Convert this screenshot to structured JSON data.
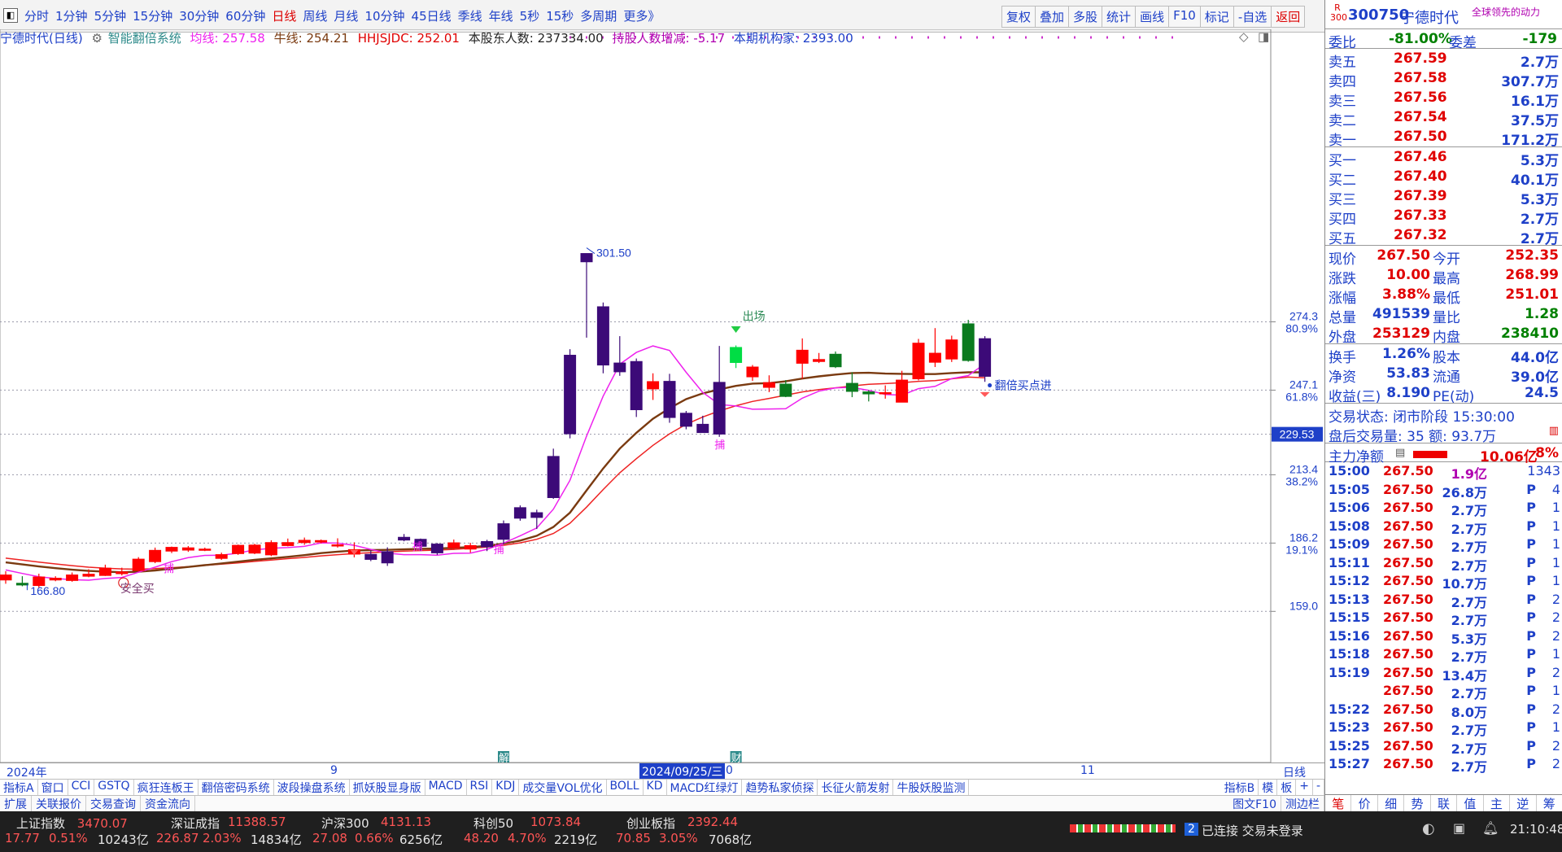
{
  "toolbar": {
    "periods": [
      "分时",
      "1分钟",
      "5分钟",
      "15分钟",
      "30分钟",
      "60分钟",
      "日线",
      "周线",
      "月线",
      "10分钟",
      "45日线",
      "季线",
      "年线",
      "5秒",
      "15秒",
      "多周期",
      "更多》"
    ],
    "active_period": "日线",
    "tools": [
      "复权",
      "叠加",
      "多股",
      "统计",
      "画线",
      "F10",
      "标记",
      "-自选",
      "返回"
    ]
  },
  "chart_info": {
    "stock": "宁德时代(日线)",
    "system": "智能翻倍系统",
    "junxian": "均线: 257.58",
    "niuxian": "牛线: 254.21",
    "hhjsjdc": "HHJSJDC: 252.01",
    "holders": "本股东人数: 237334.00",
    "holders_change": "持股人数增减: -5.17",
    "institutions": "本期机构家: 2393.00"
  },
  "chart_data": {
    "type": "candlestick",
    "yticks": [
      {
        "price": "274.3",
        "pct": "80.9%"
      },
      {
        "price": "247.1",
        "pct": "61.8%"
      },
      {
        "price": "229.53",
        "pct": ""
      },
      {
        "price": "213.4",
        "pct": "38.2%"
      },
      {
        "price": "186.2",
        "pct": "19.1%"
      },
      {
        "price": "159.0",
        "pct": ""
      }
    ],
    "ylim": [
      156,
      312
    ],
    "candles": [
      [
        1,
        173.5,
        171.5,
        175,
        170
      ],
      [
        0,
        169.5,
        170.2,
        173,
        169
      ],
      [
        1,
        169.3,
        172.7,
        174,
        168.5
      ],
      [
        1,
        171.5,
        172.2,
        173,
        171
      ],
      [
        1,
        171.3,
        173.5,
        174.5,
        170.8
      ],
      [
        1,
        173,
        173.8,
        175.8,
        172.6
      ],
      [
        1,
        173.3,
        176.2,
        177.6,
        173.1
      ],
      [
        1,
        174,
        174.7,
        176.4,
        173.3
      ],
      [
        1,
        175.3,
        179.8,
        180.6,
        175
      ],
      [
        1,
        178.8,
        183.3,
        184.4,
        178.2
      ],
      [
        1,
        183,
        184.5,
        184.8,
        182.2
      ],
      [
        1,
        183.4,
        184.3,
        185,
        182.7
      ],
      [
        1,
        183.4,
        183.8,
        184.4,
        183
      ],
      [
        1,
        180.1,
        181.6,
        182.4,
        179.5
      ],
      [
        1,
        182,
        185.3,
        185.6,
        181.5
      ],
      [
        1,
        182.2,
        185.4,
        185.9,
        181.8
      ],
      [
        1,
        181.5,
        186.4,
        187.3,
        181
      ],
      [
        1,
        186.4,
        185.2,
        188,
        184.9
      ],
      [
        1,
        186.4,
        187.3,
        188.4,
        185.5
      ],
      [
        1,
        187.2,
        186.6,
        187.6,
        186.1
      ],
      [
        1,
        185.5,
        185.4,
        188.1,
        184.4
      ],
      [
        1,
        183.6,
        181.8,
        186.5,
        180.5
      ],
      [
        0,
        181.7,
        179.7,
        183.2,
        179
      ],
      [
        0,
        182.8,
        178.3,
        184.5,
        177.1
      ],
      [
        0,
        188.5,
        187.4,
        189.8,
        186.9
      ],
      [
        0,
        184.9,
        187.7,
        188,
        183
      ],
      [
        0,
        185.8,
        182.3,
        186.2,
        181.5
      ],
      [
        1,
        184.3,
        186.3,
        187.6,
        183.6
      ],
      [
        1,
        183.8,
        185.2,
        186.3,
        182.4
      ],
      [
        0,
        186.8,
        184.7,
        187.5,
        183
      ],
      [
        0,
        187.7,
        193.9,
        195.2,
        185.8
      ],
      [
        0,
        200.3,
        196.1,
        201.2,
        195.1
      ],
      [
        0,
        198.3,
        196.4,
        199.5,
        191.8
      ],
      [
        0,
        204.3,
        220.7,
        223.8,
        203.8
      ],
      [
        0,
        229.7,
        261,
        263.4,
        227.9
      ],
      [
        0,
        301.5,
        298.2,
        301.5,
        268
      ],
      [
        0,
        257.1,
        280.3,
        282,
        253.8
      ],
      [
        0,
        257.9,
        254.4,
        268.6,
        252.8
      ],
      [
        0,
        258.5,
        239.3,
        259.7,
        236.4
      ],
      [
        1,
        247.6,
        250.5,
        253.8,
        243.2
      ],
      [
        0,
        250.6,
        236.2,
        253.6,
        234.1
      ],
      [
        0,
        232.7,
        237.9,
        238.8,
        231.5
      ],
      [
        0,
        233.5,
        230.2,
        236.9,
        230.1
      ],
      [
        0,
        229.6,
        250.2,
        264.7,
        228.5
      ],
      [
        2,
        264.1,
        258.1,
        264.9,
        255.9
      ],
      [
        1,
        252.4,
        256.3,
        257.1,
        250.8
      ],
      [
        1,
        250.1,
        248.2,
        253,
        246.3
      ],
      [
        0,
        244.6,
        249.5,
        251.1,
        244.3
      ],
      [
        1,
        257.8,
        263,
        267.7,
        251.6
      ],
      [
        1,
        258.5,
        259.3,
        261.9,
        257.9
      ],
      [
        0,
        256.4,
        261.4,
        262.5,
        255.9
      ],
      [
        0,
        249.8,
        246.6,
        254.2,
        244.3
      ],
      [
        0,
        245.6,
        246.4,
        247.1,
        242.6
      ],
      [
        1,
        246.1,
        246,
        249,
        243.7
      ],
      [
        1,
        242.3,
        251.1,
        254.8,
        242.3
      ],
      [
        1,
        251.6,
        265.8,
        267.5,
        251
      ],
      [
        1,
        258.2,
        261.8,
        271.8,
        256.3
      ],
      [
        1,
        259.5,
        267.1,
        268.8,
        258.3
      ],
      [
        0,
        273.5,
        258.9,
        275.1,
        258.4
      ],
      [
        0,
        267.6,
        252.6,
        268.6,
        250.4
      ]
    ],
    "ma_pink": [
      175.5,
      174.1,
      172.8,
      172.1,
      171.6,
      171.4,
      172.1,
      172.5,
      174.6,
      176.6,
      178.8,
      180.4,
      181.3,
      181.4,
      182.2,
      183.5,
      184.1,
      184.4,
      184.9,
      186.3,
      186.2,
      185.3,
      183.7,
      182.2,
      181.6,
      181.6,
      181.4,
      182.1,
      182.2,
      183.7,
      186.2,
      189.1,
      192.2,
      199.7,
      211.2,
      228.8,
      244.7,
      257.4,
      262.1,
      264.7,
      262.9,
      254.2,
      246.2,
      241.4,
      240.8,
      239.5,
      239.6,
      239.7,
      243.9,
      246.7,
      248,
      248.2,
      247,
      245.4,
      245.1,
      247.7,
      248.6,
      251.7,
      252.9,
      257.6
    ],
    "ma_brown": [
      178.5,
      177.7,
      176.9,
      176.2,
      175.6,
      175.1,
      174.8,
      174.6,
      174.8,
      175.3,
      176,
      176.7,
      177.4,
      178.1,
      178.8,
      179.5,
      180.1,
      180.7,
      181.4,
      182.2,
      182.8,
      183.2,
      183.4,
      183.5,
      183.7,
      183.9,
      184,
      184.3,
      184.6,
      185.1,
      186,
      187.2,
      189.1,
      192.6,
      198.3,
      207.2,
      215.9,
      223.8,
      230.1,
      235.7,
      239.9,
      243.5,
      245.8,
      247.4,
      248.8,
      249.7,
      249.9,
      250.6,
      251.7,
      252.6,
      253.3,
      253.9,
      254,
      253.7,
      253.6,
      253.5,
      253.5,
      253.9,
      254.2,
      254.2
    ],
    "ma_red": [
      180.2,
      179.4,
      178.6,
      177.9,
      177.2,
      176.6,
      176.2,
      175.9,
      175.8,
      176,
      176.4,
      176.8,
      177.3,
      177.8,
      178.3,
      178.9,
      179.4,
      180,
      180.5,
      181.1,
      181.6,
      182,
      182.4,
      182.7,
      183,
      183.2,
      183.4,
      183.7,
      184.1,
      184.6,
      185.3,
      186.3,
      187.7,
      190,
      194.1,
      200.5,
      207.5,
      214.2,
      219.8,
      225.1,
      229.7,
      233.5,
      236.4,
      238.8,
      240.9,
      242.6,
      243.8,
      245.1,
      246.4,
      247.3,
      248,
      248.8,
      249.4,
      249.7,
      250.1,
      250.6,
      250.9,
      251.6,
      252.3,
      252
    ]
  },
  "chart_labels": {
    "high_label": "301.50",
    "low_label": "166.80",
    "safe_buy": "安全买",
    "exit": "出场",
    "double_buy": "翻倍买点进",
    "bu1": "捕",
    "bu2": "捕",
    "bu3": "捕",
    "bu4": "捕",
    "jie": "解",
    "cai": "财",
    "price_badge": "229.53"
  },
  "xaxis": {
    "year": "2024年",
    "m9": "9",
    "date_marker": "2024/09/25/三",
    "m10": "0",
    "m11": "11",
    "period": "日线"
  },
  "indicator_tabs": [
    "指标A",
    "窗口",
    "CCI",
    "GSTQ",
    "疯狂连板王",
    "翻倍密码系统",
    "波段操盘系统",
    "抓妖股显身版",
    "MACD",
    "RSI",
    "KDJ",
    "成交量VOL优化",
    "BOLL",
    "KD",
    "MACD红绿灯",
    "趋势私家侦探",
    "长征火箭发射",
    "牛股妖股监测"
  ],
  "indicator_tabs_right": [
    "指标B",
    "模",
    "板",
    "+",
    "-"
  ],
  "subtabs": [
    "扩展",
    "关联报价",
    "交易查询",
    "资金流向"
  ],
  "subtabs_right": [
    "图文F10",
    "测边栏"
  ],
  "quote": {
    "code": "300750",
    "name": "宁德时代",
    "slogan": "全球领先的动力",
    "weibi_label": "委比",
    "weibi": "-81.00%",
    "weicha_label": "委差",
    "weicha": "-179",
    "sell": [
      {
        "label": "卖五",
        "price": "267.59",
        "vol": "2.7万"
      },
      {
        "label": "卖四",
        "price": "267.58",
        "vol": "307.7万"
      },
      {
        "label": "卖三",
        "price": "267.56",
        "vol": "16.1万"
      },
      {
        "label": "卖二",
        "price": "267.54",
        "vol": "37.5万"
      },
      {
        "label": "卖一",
        "price": "267.50",
        "vol": "171.2万"
      }
    ],
    "buy": [
      {
        "label": "买一",
        "price": "267.46",
        "vol": "5.3万"
      },
      {
        "label": "买二",
        "price": "267.40",
        "vol": "40.1万"
      },
      {
        "label": "买三",
        "price": "267.39",
        "vol": "5.3万"
      },
      {
        "label": "买四",
        "price": "267.33",
        "vol": "2.7万"
      },
      {
        "label": "买五",
        "price": "267.32",
        "vol": "2.7万"
      }
    ],
    "stats": [
      [
        "现价",
        "267.50",
        "今开",
        "252.35"
      ],
      [
        "涨跌",
        "10.00",
        "最高",
        "268.99"
      ],
      [
        "涨幅",
        "3.88%",
        "最低",
        "251.01"
      ],
      [
        "总量",
        "491539",
        "量比",
        "1.28"
      ],
      [
        "外盘",
        "253129",
        "内盘",
        "238410"
      ]
    ],
    "stats2": [
      [
        "换手",
        "1.26%",
        "股本",
        "44.0亿"
      ],
      [
        "净资",
        "53.83",
        "流通",
        "39.0亿"
      ],
      [
        "收益(三)",
        "8.190",
        "PE(动)",
        "24.5"
      ]
    ],
    "trade_status": "交易状态: 闭市阶段 15:30:00",
    "after_trade": "盘后交易量: 35  额: 93.7万",
    "main_flow_label": "主力净额",
    "main_flow": "10.06亿",
    "main_flow_pct": "8%",
    "ticks": [
      [
        "15:00",
        "267.50",
        "1.9亿",
        "",
        "1343"
      ],
      [
        "15:05",
        "267.50",
        "26.8万",
        "P",
        "4"
      ],
      [
        "15:06",
        "267.50",
        "2.7万",
        "P",
        "1"
      ],
      [
        "15:08",
        "267.50",
        "2.7万",
        "P",
        "1"
      ],
      [
        "15:09",
        "267.50",
        "2.7万",
        "P",
        "1"
      ],
      [
        "15:11",
        "267.50",
        "2.7万",
        "P",
        "1"
      ],
      [
        "15:12",
        "267.50",
        "10.7万",
        "P",
        "1"
      ],
      [
        "15:13",
        "267.50",
        "2.7万",
        "P",
        "2"
      ],
      [
        "15:15",
        "267.50",
        "2.7万",
        "P",
        "2"
      ],
      [
        "15:16",
        "267.50",
        "5.3万",
        "P",
        "2"
      ],
      [
        "15:18",
        "267.50",
        "2.7万",
        "P",
        "1"
      ],
      [
        "15:19",
        "267.50",
        "13.4万",
        "P",
        "2"
      ],
      [
        "",
        "267.50",
        "2.7万",
        "P",
        "1"
      ],
      [
        "15:22",
        "267.50",
        "8.0万",
        "P",
        "2"
      ],
      [
        "15:23",
        "267.50",
        "2.7万",
        "P",
        "1"
      ],
      [
        "15:25",
        "267.50",
        "2.7万",
        "P",
        "2"
      ],
      [
        "15:27",
        "267.50",
        "2.7万",
        "P",
        "2"
      ]
    ],
    "bottom_tabs": [
      "笔",
      "价",
      "细",
      "势",
      "联",
      "值",
      "主",
      "逆",
      "筹"
    ]
  },
  "status": {
    "idx1_name": "上证指数",
    "idx1_val": "3470.07",
    "idx1_chg": "17.77",
    "idx1_pct": "0.51%",
    "idx1_amt": "10243亿",
    "idx2_name": "深证成指",
    "idx2_val": "11388.57",
    "idx2_chg": "226.87",
    "idx2_pct": "2.03%",
    "idx2_amt": "14834亿",
    "idx3_name": "沪深300",
    "idx3_val": "4131.13",
    "idx3_chg": "27.08",
    "idx3_pct": "0.66%",
    "idx3_amt": "6256亿",
    "idx4_name": "科创50",
    "idx4_val": "1073.84",
    "idx4_chg": "48.20",
    "idx4_pct": "4.70%",
    "idx4_amt": "2219亿",
    "idx5_name": "创业板指",
    "idx5_val": "2392.44",
    "idx5_chg": "70.85",
    "idx5_pct": "3.05%",
    "idx5_amt": "7068亿",
    "conn_num": "2",
    "conn_text": "已连接 交易未登录",
    "time": "21:10:48"
  },
  "colors": {
    "up": "#ff0000",
    "down": "#3c0a78",
    "flat": "#0a7a1e",
    "exit": "#00dd44",
    "ma_pink": "#ee22ee",
    "ma_brown": "#7a3a10",
    "ma_red": "#ee2222",
    "link": "#1e40c8"
  }
}
